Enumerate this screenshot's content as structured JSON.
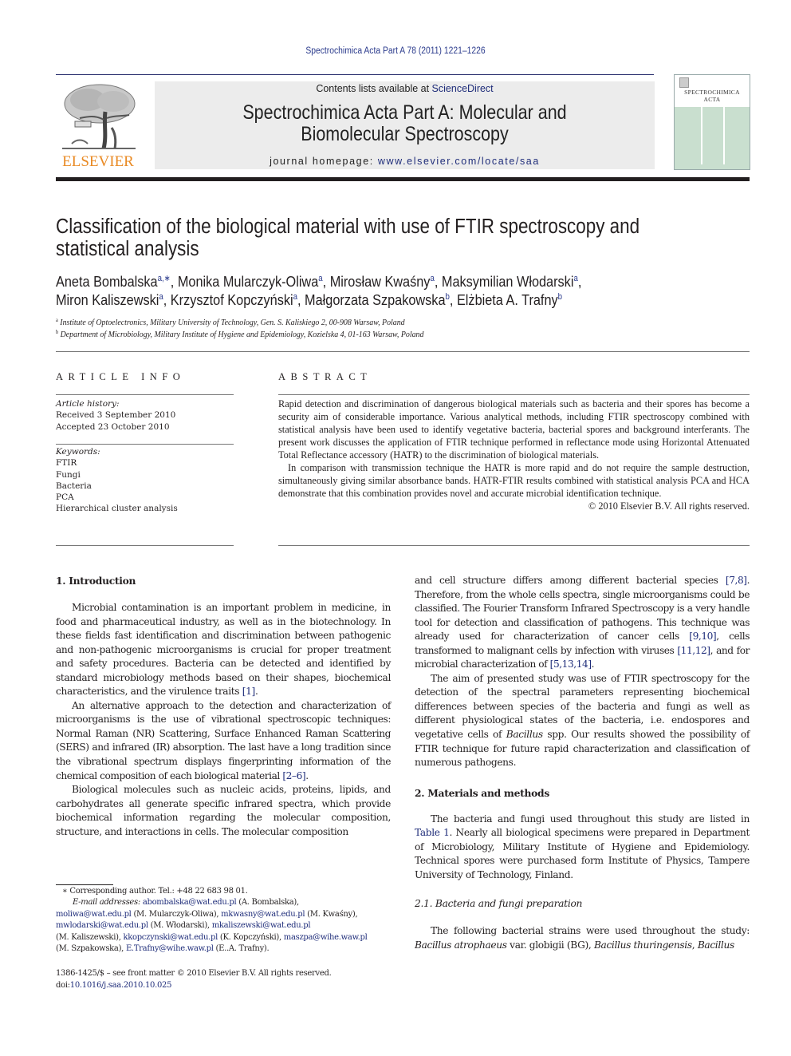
{
  "running_head": "Spectrochimica Acta Part A 78 (2011) 1221–1226",
  "publisher": {
    "logo_icon": "elsevier-tree-icon",
    "name": "ELSEVIER"
  },
  "masthead": {
    "contents_prefix": "Contents lists available at ",
    "contents_link": "ScienceDirect",
    "journal_title_line1": "Spectrochimica Acta Part A: Molecular and",
    "journal_title_line2": "Biomolecular Spectroscopy",
    "homepage_prefix": "journal homepage: ",
    "homepage_link": "www.elsevier.com/locate/saa"
  },
  "cover": {
    "title_line1": "SPECTROCHIMICA",
    "title_line2": "ACTA",
    "color": "#c9dfcf"
  },
  "article": {
    "title_line1": "Classification of the biological material with use of FTIR spectroscopy and",
    "title_line2": "statistical analysis",
    "authors": [
      {
        "name": "Aneta Bombalska",
        "aff": "a,∗",
        "sep": ", "
      },
      {
        "name": "Monika Mularczyk-Oliwa",
        "aff": "a",
        "sep": ", "
      },
      {
        "name": "Mirosław Kwaśny",
        "aff": "a",
        "sep": ", "
      },
      {
        "name": "Maksymilian Włodarski",
        "aff": "a",
        "sep": ","
      },
      {
        "name": "Miron Kaliszewski",
        "aff": "a",
        "sep": ", "
      },
      {
        "name": "Krzysztof Kopczyński",
        "aff": "a",
        "sep": ", "
      },
      {
        "name": "Małgorzata Szpakowska",
        "aff": "b",
        "sep": ", "
      },
      {
        "name": "Elżbieta A. Trafny",
        "aff": "b",
        "sep": ""
      }
    ],
    "affiliations": [
      {
        "key": "a",
        "text": "Institute of Optoelectronics, Military University of Technology, Gen. S. Kaliskiego 2, 00-908 Warsaw, Poland"
      },
      {
        "key": "b",
        "text": "Department of Microbiology, Military Institute of Hygiene and Epidemiology, Kozielska 4, 01-163 Warsaw, Poland"
      }
    ]
  },
  "article_info": {
    "heading": "ARTICLE INFO",
    "history_label": "Article history:",
    "received": "Received 3 September 2010",
    "accepted": "Accepted 23 October 2010",
    "keywords_label": "Keywords:",
    "keywords": [
      "FTIR",
      "Fungi",
      "Bacteria",
      "PCA",
      "Hierarchical cluster analysis"
    ]
  },
  "abstract": {
    "heading": "ABSTRACT",
    "p1": "Rapid detection and discrimination of dangerous biological materials such as bacteria and their spores has become a security aim of considerable importance. Various analytical methods, including FTIR spectroscopy combined with statistical analysis have been used to identify vegetative bacteria, bacterial spores and background interferants. The present work discusses the application of FTIR technique performed in reflectance mode using Horizontal Attenuated Total Reflectance accessory (HATR) to the discrimination of biological materials.",
    "p2": "In comparison with transmission technique the HATR is more rapid and do not require the sample destruction, simultaneously giving similar absorbance bands. HATR-FTIR results combined with statistical analysis PCA and HCA demonstrate that this combination provides novel and accurate microbial identification technique.",
    "copyright": "© 2010 Elsevier B.V. All rights reserved."
  },
  "body": {
    "intro_heading": "1.  Introduction",
    "intro_p1_text": "Microbial contamination is an important problem in medicine, in food and pharmaceutical industry, as well as in the biotechnology. In these fields fast identification and discrimination between pathogenic and non-pathogenic microorganisms is crucial for proper treatment and safety procedures. Bacteria can be detected and identified by standard microbiology methods based on their shapes, biochemical characteristics, and the virulence traits ",
    "intro_p1_ref": "[1]",
    "intro_p2_text": "An alternative approach to the detection and characterization of microorganisms is the use of vibrational spectroscopic techniques: Normal Raman (NR) Scattering, Surface Enhanced Raman Scattering (SERS) and infrared (IR) absorption. The last have a long tradition since the vibrational spectrum displays fingerprinting information of the chemical composition of each biological material ",
    "intro_p2_ref": "[2–6]",
    "intro_p3_text": "Biological molecules such as nucleic acids, proteins, lipids, and carbohydrates all generate specific infrared spectra, which provide biochemical information regarding the molecular composition, structure, and interactions in cells. The molecular composition",
    "right_p1_a": "and cell structure differs among different bacterial species ",
    "right_p1_ref1": "[7,8]",
    "right_p1_b": ". Therefore, from the whole cells spectra, single microorganisms could be classified. The Fourier Transform Infrared Spectroscopy is a very handle tool for detection and classification of pathogens. This technique was already used for characterization of cancer cells ",
    "right_p1_ref2": "[9,10]",
    "right_p1_c": ", cells transformed to malignant cells by infection with viruses ",
    "right_p1_ref3": "[11,12]",
    "right_p1_d": ", and for microbial characterization of ",
    "right_p1_ref4": "[5,13,14]",
    "right_p2_a": "The aim of presented study was use of FTIR spectroscopy for the detection of the spectral parameters representing biochemical differences between species of the bacteria and fungi as well as different physiological states of the bacteria, i.e. endospores and vegetative cells of ",
    "right_p2_italic": "Bacillus",
    "right_p2_b": " spp. Our results showed the possibility of FTIR technique for future rapid characterization and classification of numerous pathogens.",
    "methods_heading": "2.  Materials and methods",
    "methods_p1_a": "The bacteria and fungi used throughout this study are listed in ",
    "methods_p1_ref": "Table 1",
    "methods_p1_b": ". Nearly all biological specimens were prepared in Department of Microbiology, Military Institute of Hygiene and Epidemiology. Technical spores were purchased form Institute of Physics, Tampere University of Technology, Finland.",
    "sub_heading": "2.1.  Bacteria and fungi preparation",
    "sub_p1_a": "The following bacterial strains were used throughout the study: ",
    "sub_p1_i1": "Bacillus atrophaeus",
    "sub_p1_b": " var. globigii (BG), ",
    "sub_p1_i2": "Bacillus thuringensis",
    "sub_p1_c": ", ",
    "sub_p1_i3": "Bacillus"
  },
  "footnotes": {
    "corresponding": "∗ Corresponding author. Tel.: +48 22 683 98 01.",
    "email_label": "E-mail addresses:",
    "emails": [
      {
        "email": "abombalska@wat.edu.pl",
        "name": " (A. Bombalska),"
      },
      {
        "email": "moliwa@wat.edu.pl",
        "name": " (M. Mularczyk-Oliwa), "
      },
      {
        "email": "mkwasny@wat.edu.pl",
        "name": " (M. Kwaśny),"
      },
      {
        "email": "mwlodarski@wat.edu.pl",
        "name": " (M. Włodarski), "
      },
      {
        "email": "mkaliszewski@wat.edu.pl",
        "name": ""
      },
      {
        "email": "kkopczynski@wat.edu.pl",
        "name": " (K. Kopczyński), "
      },
      {
        "email": "maszpa@wihe.waw.pl",
        "name": ""
      },
      {
        "email": "E.Trafny@wihe.waw.pl",
        "name": " (E..A. Trafny)."
      }
    ],
    "kaliszewski_name": "(M. Kaliszewski), ",
    "szpakowska_name": "(M. Szpakowska), ",
    "front_matter": "1386-1425/$ – see front matter © 2010 Elsevier B.V. All rights reserved.",
    "doi_prefix": "doi:",
    "doi": "10.1016/j.saa.2010.10.025"
  }
}
